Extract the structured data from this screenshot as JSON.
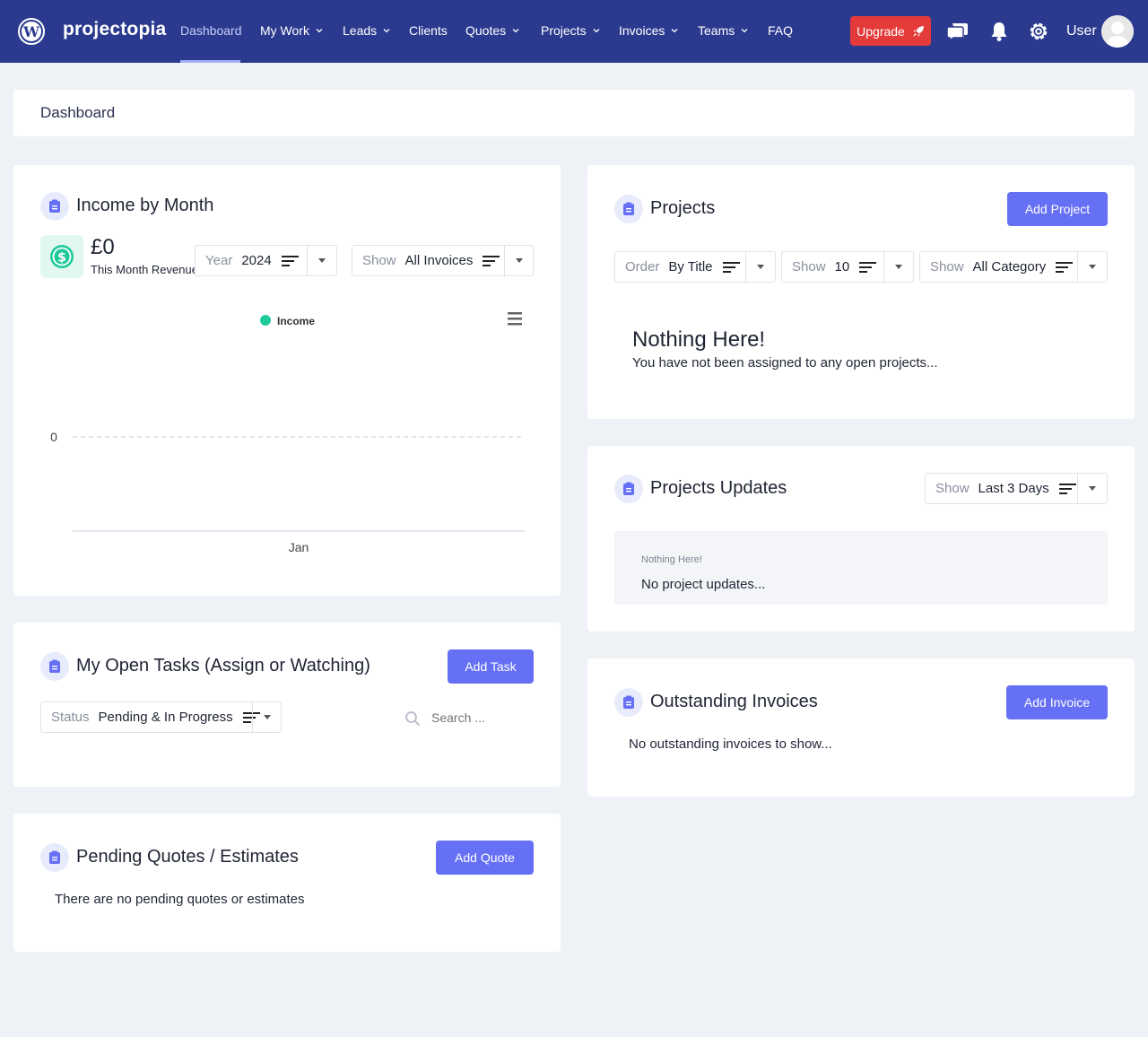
{
  "nav": {
    "brand": "projectopia",
    "items": [
      {
        "label": "Dashboard"
      },
      {
        "label": "My Work"
      },
      {
        "label": "Leads"
      },
      {
        "label": "Clients"
      },
      {
        "label": "Quotes"
      },
      {
        "label": "Projects"
      },
      {
        "label": "Invoices"
      },
      {
        "label": "Teams"
      },
      {
        "label": "FAQ"
      }
    ],
    "upgrade_label": "Upgrade",
    "user_label": "User"
  },
  "breadcrumb": {
    "title": "Dashboard"
  },
  "income": {
    "title": "Income by Month",
    "amount": "£0",
    "amount_caption": "This Month Revenue",
    "year_label": "Year",
    "year_value": "2024",
    "show_label": "Show",
    "show_value": "All Invoices"
  },
  "chart_data": {
    "type": "line",
    "categories": [
      "Jan"
    ],
    "series": [
      {
        "name": "Income",
        "values": [
          0
        ],
        "color": "#1fc99a"
      }
    ],
    "yticks": [
      "0"
    ],
    "grid": true,
    "legend": "top-center"
  },
  "tasks": {
    "title": "My Open Tasks (Assign or Watching)",
    "add_label": "Add Task",
    "status_label": "Status",
    "status_value": "Pending & In Progress",
    "search_placeholder": "Search ..."
  },
  "quotes": {
    "title": "Pending Quotes / Estimates",
    "add_label": "Add Quote",
    "empty": "There are no pending quotes or estimates"
  },
  "projects": {
    "title": "Projects",
    "add_label": "Add Project",
    "order_label": "Order",
    "order_value": "By Title",
    "show_label": "Show",
    "show_value": "10",
    "cat_label": "Show",
    "cat_value": "All Category",
    "empty_title": "Nothing Here!",
    "empty_text": "You have not been assigned to any open projects..."
  },
  "updates": {
    "title": "Projects Updates",
    "show_label": "Show",
    "show_value": "Last 3 Days",
    "empty_title": "Nothing Here!",
    "empty_text": "No project updates..."
  },
  "invoices": {
    "title": "Outstanding Invoices",
    "add_label": "Add Invoice",
    "empty": "No outstanding invoices to show..."
  },
  "colors": {
    "nav": "#2b3a8f",
    "accent": "#6570f5",
    "upgrade": "#e53a3a",
    "income": "#1fc99a"
  }
}
